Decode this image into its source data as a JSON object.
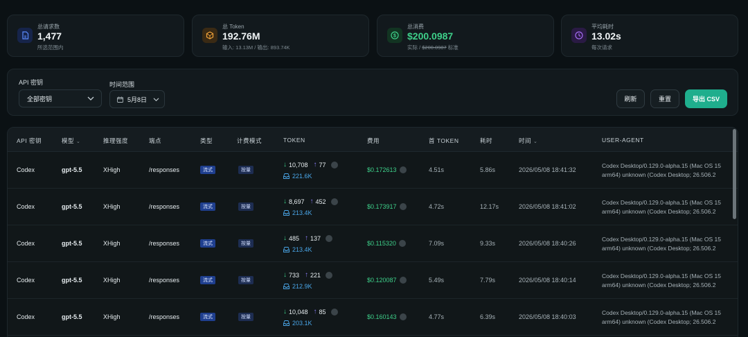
{
  "stats": [
    {
      "label": "总请求数",
      "value": "1,477",
      "sub": "所选范围内",
      "icon": "file-icon",
      "accent": "#4a7cf0"
    },
    {
      "label": "总 Token",
      "value": "192.76M",
      "sub": "输入: 13.13M / 输出: 893.74K",
      "icon": "box-icon",
      "accent": "#f0a23a"
    },
    {
      "label": "总消费",
      "value": "$200.0987",
      "sub_prefix": "实际 / ",
      "sub_strike": "$200.0987",
      "sub_suffix": " 标准",
      "icon": "dollar-icon",
      "accent": "#3ed08a"
    },
    {
      "label": "平均耗时",
      "value": "13.02s",
      "sub": "每次请求",
      "icon": "clock-icon",
      "accent": "#a46cf2"
    }
  ],
  "filters": {
    "api_key_label": "API 密钥",
    "api_key_value": "全部密钥",
    "time_label": "时间范围",
    "time_value": "5月8日",
    "refresh": "刷新",
    "reset": "重置",
    "export": "导出 CSV"
  },
  "table": {
    "headers": {
      "api_key": "API 密钥",
      "model": "模型",
      "reasoning": "推理强度",
      "endpoint": "端点",
      "type": "类型",
      "billing": "计费模式",
      "token": "TOKEN",
      "cost": "费用",
      "first_token": "首 TOKEN",
      "duration": "耗时",
      "time": "时间",
      "user_agent": "USER-AGENT"
    },
    "rows": [
      {
        "api_key": "Codex",
        "model": "gpt-5.5",
        "reasoning": "XHigh",
        "endpoint": "/responses",
        "type": "流式",
        "billing": "按量",
        "tok_in": "10,708",
        "tok_out": "77",
        "tok_cache": "221.6K",
        "cost": "$0.172613",
        "first_token": "4.51s",
        "duration": "5.86s",
        "time": "2026/05/08 18:41:32",
        "ua1": "Codex Desktop/0.129.0-alpha.15 (Mac OS 15",
        "ua2": "arm64) unknown (Codex Desktop; 26.506.2"
      },
      {
        "api_key": "Codex",
        "model": "gpt-5.5",
        "reasoning": "XHigh",
        "endpoint": "/responses",
        "type": "流式",
        "billing": "按量",
        "tok_in": "8,697",
        "tok_out": "452",
        "tok_cache": "213.4K",
        "cost": "$0.173917",
        "first_token": "4.72s",
        "duration": "12.17s",
        "time": "2026/05/08 18:41:02",
        "ua1": "Codex Desktop/0.129.0-alpha.15 (Mac OS 15",
        "ua2": "arm64) unknown (Codex Desktop; 26.506.2"
      },
      {
        "api_key": "Codex",
        "model": "gpt-5.5",
        "reasoning": "XHigh",
        "endpoint": "/responses",
        "type": "流式",
        "billing": "按量",
        "tok_in": "485",
        "tok_out": "137",
        "tok_cache": "213.4K",
        "cost": "$0.115320",
        "first_token": "7.09s",
        "duration": "9.33s",
        "time": "2026/05/08 18:40:26",
        "ua1": "Codex Desktop/0.129.0-alpha.15 (Mac OS 15",
        "ua2": "arm64) unknown (Codex Desktop; 26.506.2"
      },
      {
        "api_key": "Codex",
        "model": "gpt-5.5",
        "reasoning": "XHigh",
        "endpoint": "/responses",
        "type": "流式",
        "billing": "按量",
        "tok_in": "733",
        "tok_out": "221",
        "tok_cache": "212.9K",
        "cost": "$0.120087",
        "first_token": "5.49s",
        "duration": "7.79s",
        "time": "2026/05/08 18:40:14",
        "ua1": "Codex Desktop/0.129.0-alpha.15 (Mac OS 15",
        "ua2": "arm64) unknown (Codex Desktop; 26.506.2"
      },
      {
        "api_key": "Codex",
        "model": "gpt-5.5",
        "reasoning": "XHigh",
        "endpoint": "/responses",
        "type": "流式",
        "billing": "按量",
        "tok_in": "10,048",
        "tok_out": "85",
        "tok_cache": "203.1K",
        "cost": "$0.160143",
        "first_token": "4.77s",
        "duration": "6.39s",
        "time": "2026/05/08 18:40:03",
        "ua1": "Codex Desktop/0.129.0-alpha.15 (Mac OS 15",
        "ua2": "arm64) unknown (Codex Desktop; 26.506.2"
      }
    ]
  }
}
